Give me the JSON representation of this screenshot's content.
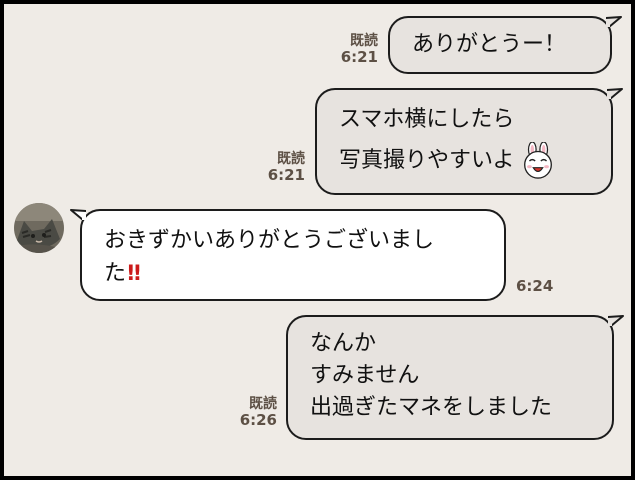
{
  "messages": [
    {
      "direction": "sent",
      "text_lines": [
        "ありがとうー！"
      ],
      "read_label": "既読",
      "time": "6:21"
    },
    {
      "direction": "sent",
      "text_lines": [
        "スマホ横にしたら",
        "写真撮りやすいよ"
      ],
      "sticker_icon": "bunny-face-icon",
      "read_label": "既読",
      "time": "6:21"
    },
    {
      "direction": "received",
      "avatar_icon": "cat-avatar-icon",
      "text_lines": [
        "おきずかいありがとうございまし",
        "た"
      ],
      "emoji": "!!",
      "time": "6:24"
    },
    {
      "direction": "sent",
      "text_lines": [
        "なんか",
        "すみません",
        "出過ぎたマネをしました"
      ],
      "read_label": "既読",
      "time": "6:26"
    }
  ],
  "colors": {
    "background": "#efebe6",
    "sent_bubble": "#e7e3df",
    "received_bubble": "#ffffff",
    "meta_text": "#5d5045",
    "exclamation": "#cc1b1b"
  }
}
